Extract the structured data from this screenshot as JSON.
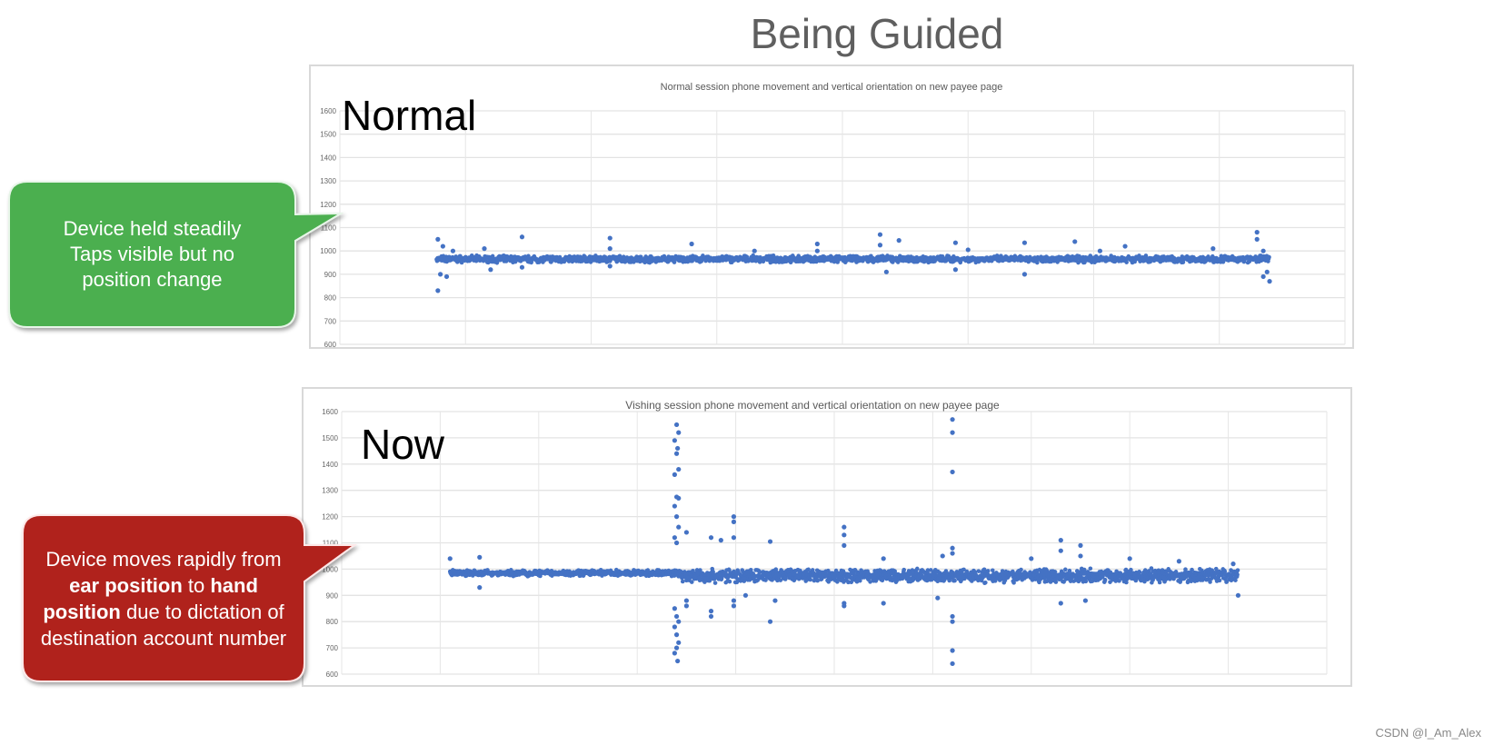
{
  "slide_title": "Being Guided",
  "callouts": {
    "green": {
      "lines": [
        "Device held steadily",
        "Taps visible but no",
        "position change"
      ],
      "color": "#4caf50"
    },
    "red": {
      "parts": [
        {
          "t": "Device moves rapidly from "
        },
        {
          "t": "ear position",
          "b": true
        },
        {
          "t": " to "
        },
        {
          "t": "hand position",
          "b": true
        },
        {
          "t": " due to dictation of destination account number"
        }
      ],
      "color": "#b0221b"
    }
  },
  "labels": {
    "normal": "Normal",
    "now": "Now"
  },
  "watermark": "CSDN @I_Am_Alex",
  "chart_data": [
    {
      "type": "scatter",
      "title": "Normal session phone movement and vertical orientation on new payee page",
      "ylim": [
        600,
        1600
      ],
      "yticks": [
        600,
        700,
        800,
        900,
        1000,
        1100,
        1200,
        1300,
        1400,
        1500,
        1600
      ],
      "xlim": [
        0,
        8
      ],
      "grid": true,
      "color": "#4472c4",
      "baseline": [
        {
          "x0": 0.77,
          "x1": 7.4,
          "center": 965,
          "spread": 10
        }
      ],
      "points": [
        [
          0.78,
          830
        ],
        [
          0.78,
          1050
        ],
        [
          0.8,
          900
        ],
        [
          0.85,
          890
        ],
        [
          0.82,
          1020
        ],
        [
          0.9,
          1000
        ],
        [
          1.15,
          1010
        ],
        [
          1.2,
          920
        ],
        [
          1.45,
          1060
        ],
        [
          1.45,
          930
        ],
        [
          2.15,
          1055
        ],
        [
          2.15,
          1010
        ],
        [
          2.15,
          935
        ],
        [
          2.8,
          1030
        ],
        [
          3.3,
          1000
        ],
        [
          3.8,
          1030
        ],
        [
          3.8,
          1000
        ],
        [
          4.3,
          1070
        ],
        [
          4.3,
          1025
        ],
        [
          4.35,
          910
        ],
        [
          4.45,
          1045
        ],
        [
          4.9,
          1035
        ],
        [
          4.9,
          920
        ],
        [
          5.45,
          1035
        ],
        [
          5.45,
          900
        ],
        [
          5.85,
          1040
        ],
        [
          6.25,
          1020
        ],
        [
          6.95,
          1010
        ],
        [
          7.3,
          1080
        ],
        [
          7.3,
          1050
        ],
        [
          7.35,
          1000
        ],
        [
          7.38,
          910
        ],
        [
          7.4,
          870
        ],
        [
          7.35,
          890
        ],
        [
          6.05,
          1000
        ],
        [
          5.0,
          1005
        ]
      ]
    },
    {
      "type": "scatter",
      "title": "Vishing session phone movement and vertical orientation on new payee page",
      "ylim": [
        600,
        1600
      ],
      "yticks": [
        600,
        700,
        800,
        900,
        1000,
        1100,
        1200,
        1300,
        1400,
        1500,
        1600
      ],
      "xlim": [
        0,
        10
      ],
      "grid": true,
      "color": "#4472c4",
      "baseline": [
        {
          "x0": 1.1,
          "x1": 3.45,
          "center": 985,
          "spread": 8
        },
        {
          "x0": 3.45,
          "x1": 9.1,
          "center": 975,
          "spread": 18
        }
      ],
      "points": [
        [
          1.1,
          1040
        ],
        [
          1.4,
          930
        ],
        [
          1.4,
          1045
        ],
        [
          3.4,
          1550
        ],
        [
          3.42,
          1520
        ],
        [
          3.38,
          1490
        ],
        [
          3.41,
          1460
        ],
        [
          3.4,
          1440
        ],
        [
          3.42,
          1380
        ],
        [
          3.38,
          1360
        ],
        [
          3.4,
          1275
        ],
        [
          3.42,
          1270
        ],
        [
          3.38,
          1240
        ],
        [
          3.4,
          1200
        ],
        [
          3.42,
          1160
        ],
        [
          3.38,
          1120
        ],
        [
          3.4,
          1100
        ],
        [
          3.38,
          850
        ],
        [
          3.4,
          820
        ],
        [
          3.42,
          800
        ],
        [
          3.38,
          780
        ],
        [
          3.4,
          750
        ],
        [
          3.42,
          720
        ],
        [
          3.4,
          700
        ],
        [
          3.38,
          680
        ],
        [
          3.41,
          650
        ],
        [
          3.5,
          1140
        ],
        [
          3.5,
          880
        ],
        [
          3.5,
          860
        ],
        [
          3.75,
          1120
        ],
        [
          3.75,
          840
        ],
        [
          3.75,
          820
        ],
        [
          3.85,
          1110
        ],
        [
          3.98,
          1200
        ],
        [
          3.98,
          1180
        ],
        [
          3.98,
          1120
        ],
        [
          3.98,
          880
        ],
        [
          3.98,
          860
        ],
        [
          4.35,
          1105
        ],
        [
          4.35,
          800
        ],
        [
          4.1,
          900
        ],
        [
          4.4,
          880
        ],
        [
          5.1,
          1160
        ],
        [
          5.1,
          1130
        ],
        [
          5.1,
          1090
        ],
        [
          5.1,
          870
        ],
        [
          5.1,
          860
        ],
        [
          5.5,
          1040
        ],
        [
          5.5,
          870
        ],
        [
          6.2,
          1570
        ],
        [
          6.2,
          1520
        ],
        [
          6.2,
          1370
        ],
        [
          6.2,
          1080
        ],
        [
          6.2,
          1060
        ],
        [
          6.2,
          820
        ],
        [
          6.2,
          800
        ],
        [
          6.2,
          690
        ],
        [
          6.2,
          640
        ],
        [
          6.1,
          1050
        ],
        [
          6.05,
          890
        ],
        [
          7.3,
          1110
        ],
        [
          7.3,
          1070
        ],
        [
          7.5,
          1090
        ],
        [
          7.5,
          1050
        ],
        [
          7.55,
          880
        ],
        [
          7.0,
          1040
        ],
        [
          7.3,
          870
        ],
        [
          8.0,
          1040
        ],
        [
          8.5,
          1030
        ],
        [
          9.1,
          900
        ],
        [
          9.05,
          1020
        ]
      ]
    }
  ]
}
